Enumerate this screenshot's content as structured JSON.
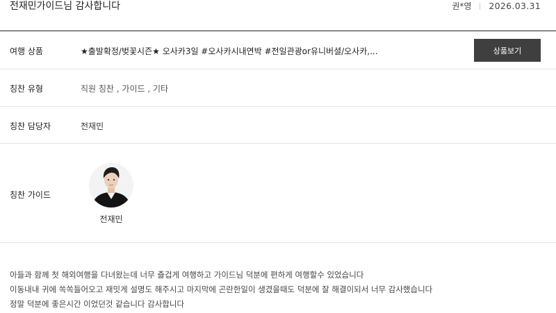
{
  "post": {
    "title": "전재민가이드님 감사합니다",
    "author": "권*영",
    "date": "2026.03.31"
  },
  "fields": {
    "product": {
      "label": "여행 상품",
      "value": "★출발확정/벚꽃시즌★ 오사카3일 #오사카시내연박 #전일관광or유니버셜/오사카,...",
      "button_label": "상품보기"
    },
    "type": {
      "label": "칭찬 유형",
      "value": "직원 칭찬 , 가이드 , 기타"
    },
    "staff": {
      "label": "칭찬 담당자",
      "value": "전재민"
    },
    "guide": {
      "label": "칭찬 가이드",
      "name": "전재민"
    }
  },
  "body": {
    "lines": [
      "아들과 함께 첫 해외여행을 다녀왔는데 너무 즐겁게 여행하고 가이드님 덕분에 편하게 여행할수 있었습니다",
      "이동내내 귀에 쏙쏙들어오고 재밋게 설명도 해주시고 마지막에 곤란한일이 생겼을때도 덕분에 잘 해결이되서 너무 감사했습니다",
      "정말 덕분에 좋은시간 이었던것 같습니다 감사합니다"
    ]
  },
  "colors": {
    "button_bg": "#3f3f3f",
    "header_rule": "#222222",
    "row_divider": "#e3e3e3"
  }
}
